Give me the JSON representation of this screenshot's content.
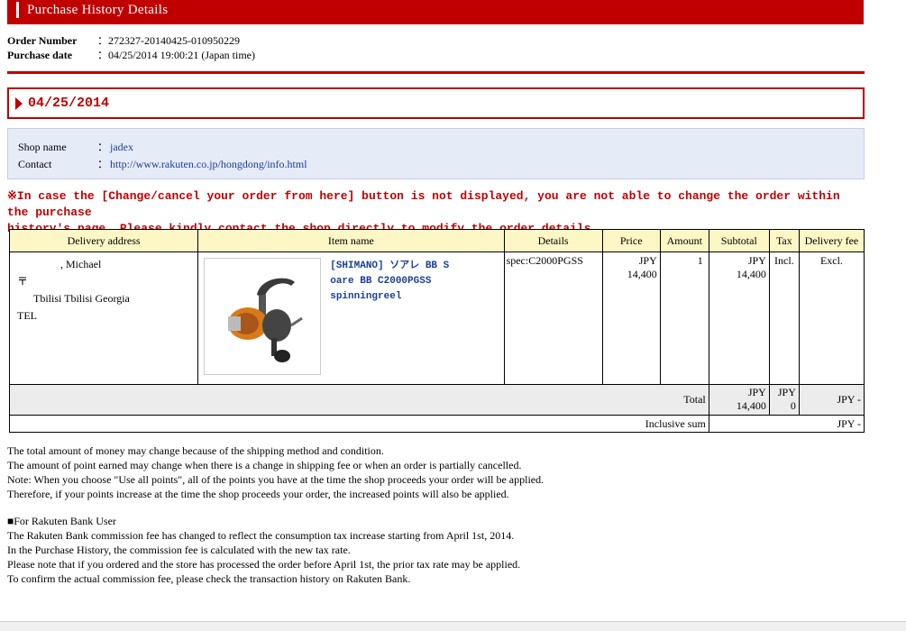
{
  "header": {
    "title": "Purchase History Details"
  },
  "order": {
    "number_label": "Order Number",
    "number_value": "：272327-20140425-010950229",
    "date_label": "Purchase date",
    "date_value": "：04/25/2014 19:00:21 (Japan time)"
  },
  "date_section": {
    "date": "04/25/2014"
  },
  "shop": {
    "name_label": "Shop name",
    "name_colon": "：",
    "name_value": "jadex",
    "contact_label": "Contact",
    "contact_colon": "：",
    "contact_value": "http://www.rakuten.co.jp/hongdong/info.html"
  },
  "warning": {
    "line1": "※In case the [Change/cancel your order from here] button is not displayed, you are not able to change the order within the purchase",
    "line2": "history's page. Please kindly contact the shop directly to modify the order details."
  },
  "table": {
    "headers": [
      "Delivery address",
      "Item name",
      "Details",
      "Price",
      "Amount",
      "Subtotal",
      "Tax",
      "Delivery fee"
    ],
    "address": {
      "line1": "　　　　, Michael",
      "line2": "〒",
      "line3": "",
      "line4": "Tbilisi Tbilisi Georgia",
      "line5": "TEL"
    },
    "item_name": "[SHIMANO] ソアレ BB S oare BB C2000PGSS spinningreel",
    "details": "spec:C2000PGSS",
    "price_currency": "JPY",
    "price_value": "14,400",
    "amount": "1",
    "subtotal_currency": "JPY",
    "subtotal_value": "14,400",
    "tax": "Incl.",
    "delivery_fee": "Excl.",
    "total_label": "Total",
    "total_subtotal_currency": "JPY",
    "total_subtotal_value": "14,400",
    "total_tax_currency": "JPY",
    "total_tax_value": "0",
    "total_delivery": "JPY -",
    "inclusive_label": "Inclusive sum",
    "inclusive_value": "JPY -"
  },
  "notes": {
    "n1": "The total amount of money may change because of the shipping method and condition.",
    "n2": "The amount of point earned may change when there is a change in shipping fee or when an order is partially cancelled.",
    "n3": "Note: When you choose \"Use all points\", all of the points you have at the time the shop proceeds your order will be applied.",
    "n4": "Therefore, if your points increase at the time the shop proceeds your order, the increased points will also be applied.",
    "bank_title": "■For Rakuten Bank User",
    "b1": "The Rakuten Bank commission fee has changed to reflect the consumption tax increase starting from April 1st, 2014.",
    "b2": "In the Purchase History, the commission fee is calculated with the new tax rate.",
    "b3": "Please note that if you ordered and the store has processed the order before April 1st, the prior tax rate may be applied.",
    "b4": "To confirm the actual commission fee, please check the transaction history on Rakuten Bank."
  },
  "colors": {
    "accent": "#c00000",
    "link": "#1a3f95",
    "shop_bg": "#e6ebf8",
    "header_bg": "#fdf7c6"
  }
}
